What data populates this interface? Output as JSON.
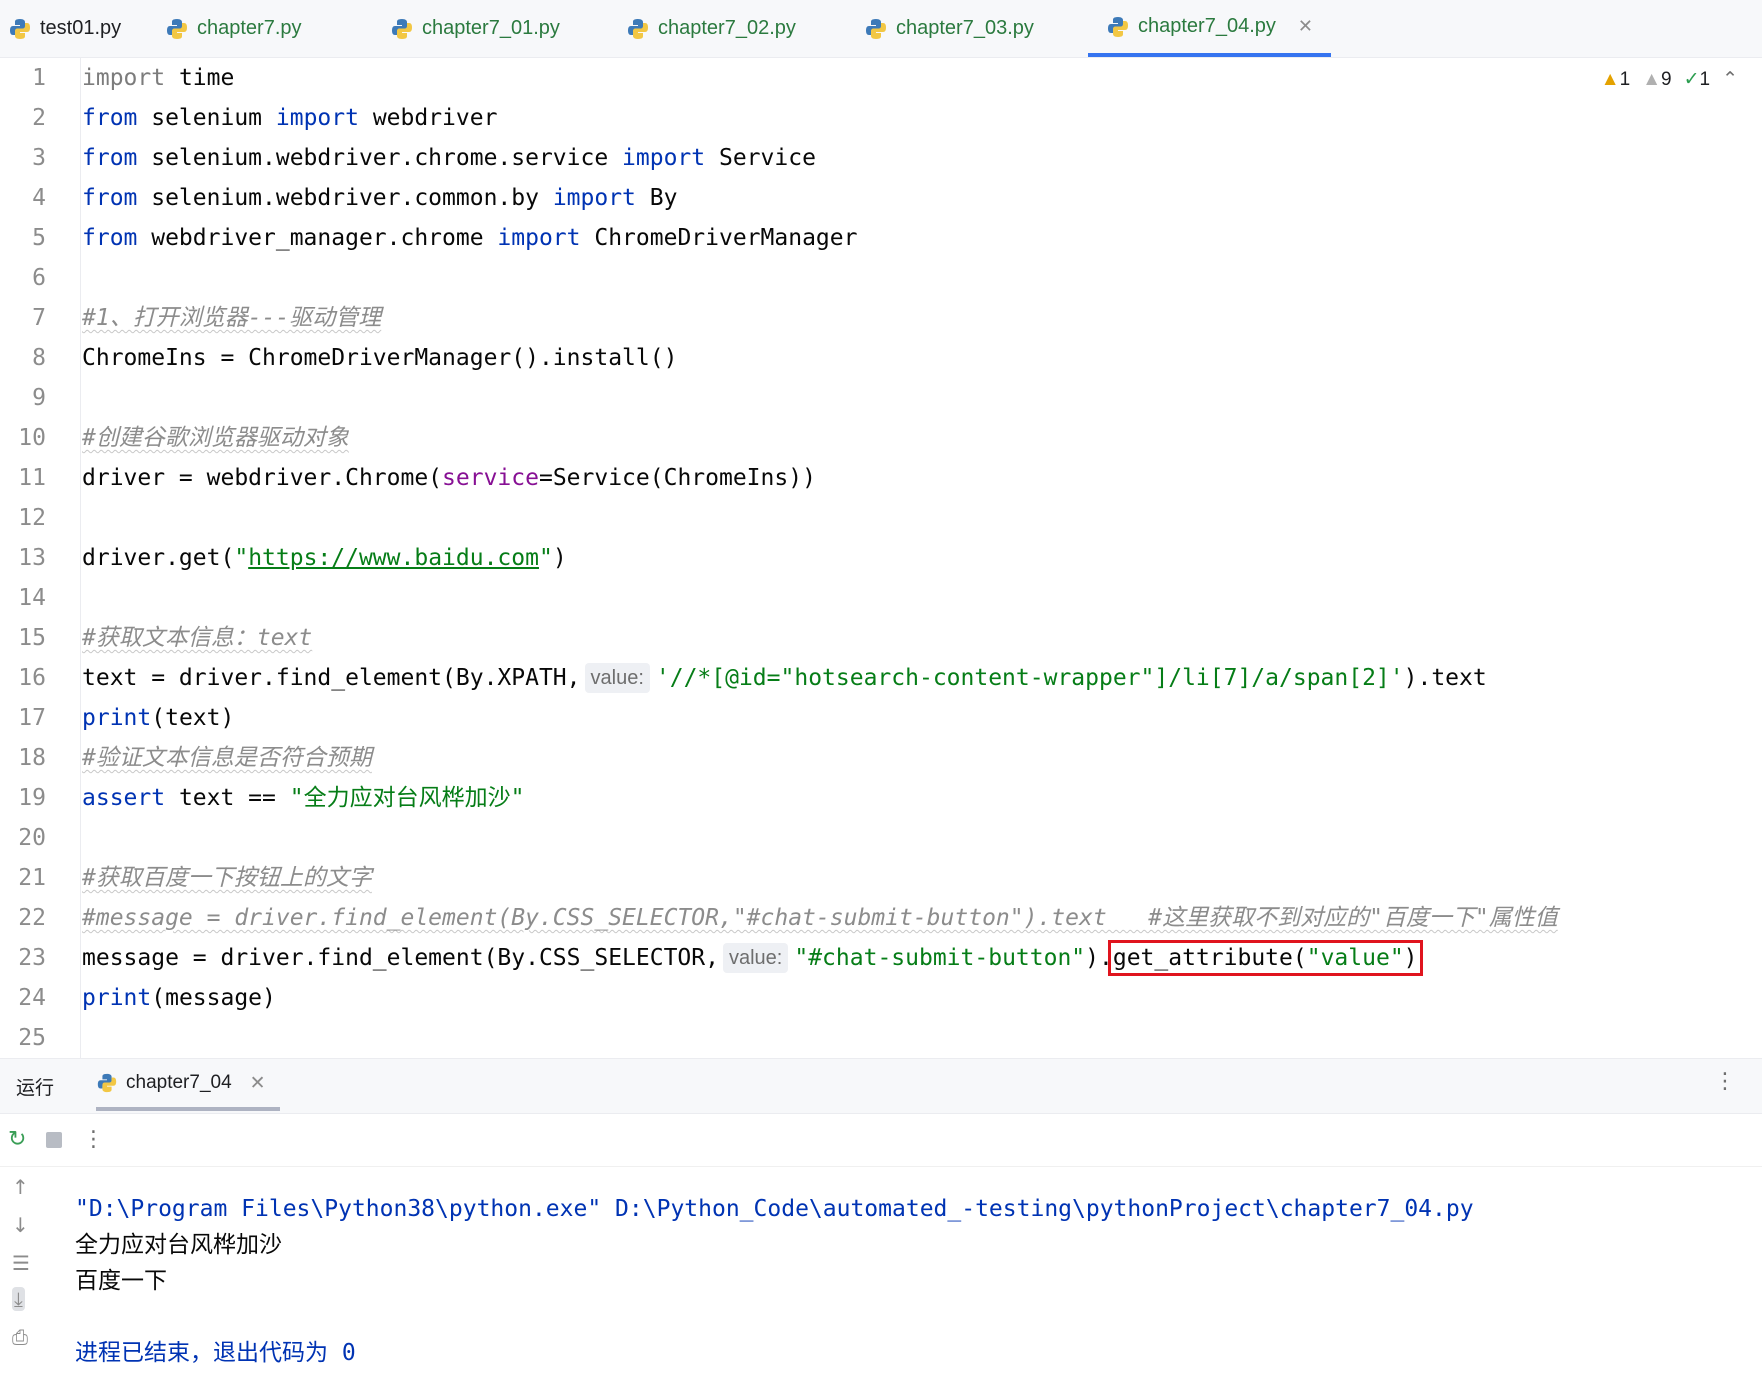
{
  "tabs": [
    {
      "label": "test01.py",
      "state": "plain"
    },
    {
      "label": "chapter7.py",
      "state": "normal"
    },
    {
      "label": "chapter7_01.py",
      "state": "normal"
    },
    {
      "label": "chapter7_02.py",
      "state": "normal"
    },
    {
      "label": "chapter7_03.py",
      "state": "normal"
    },
    {
      "label": "chapter7_04.py",
      "state": "active"
    }
  ],
  "inspections": {
    "warnings": "1",
    "weak_warnings": "9",
    "typos": "1"
  },
  "icons": {
    "python": "python-file-icon",
    "close": "close-icon",
    "warning": "warning-icon",
    "check": "check-icon"
  },
  "colors": {
    "keyword": "#0033b3",
    "string": "#067d17",
    "comment": "#8c8c8c",
    "highlight_box": "#e0141e",
    "active_tab": "#3574f0"
  },
  "editor": {
    "line_numbers": [
      "1",
      "2",
      "3",
      "4",
      "5",
      "6",
      "7",
      "8",
      "9",
      "10",
      "11",
      "12",
      "13",
      "14",
      "15",
      "16",
      "17",
      "18",
      "19",
      "20",
      "21",
      "22",
      "23",
      "24",
      "25"
    ],
    "hint_label": "value:",
    "lines": {
      "l1": {
        "a": "import",
        "b": " time"
      },
      "l2": {
        "a": "from",
        "b": " selenium ",
        "c": "import",
        "d": " webdriver"
      },
      "l3": {
        "a": "from",
        "b": " selenium.webdriver.chrome.service ",
        "c": "import",
        "d": " Service"
      },
      "l4": {
        "a": "from",
        "b": " selenium.webdriver.common.by ",
        "c": "import",
        "d": " By"
      },
      "l5": {
        "a": "from",
        "b": " webdriver_manager.chrome ",
        "c": "import",
        "d": " ChromeDriverManager"
      },
      "l7": {
        "comment": "#1、打开浏览器---驱动管理"
      },
      "l8": {
        "code": "ChromeIns = ChromeDriverManager().install()"
      },
      "l10": {
        "comment": "#创建谷歌浏览器驱动对象"
      },
      "l11": {
        "a": "driver = webdriver.Chrome(",
        "b": "service",
        "c": "=Service(ChromeIns))"
      },
      "l13": {
        "a": "driver.get(",
        "q1": "\"",
        "url": "https://www.baidu.com",
        "q2": "\"",
        "b": ")"
      },
      "l15": {
        "comment": "#获取文本信息：text"
      },
      "l16": {
        "a": "text = driver.find_element(By.XPATH,",
        "str": "'//*[@id=\"hotsearch-content-wrapper\"]/li[7]/a/span[2]'",
        "b": ").text"
      },
      "l17": {
        "a": "print",
        "b": "(text)"
      },
      "l18": {
        "comment": "#验证文本信息是否符合预期"
      },
      "l19": {
        "a": "assert",
        "b": " text == ",
        "str": "\"全力应对台风桦加沙\""
      },
      "l21": {
        "comment": "#获取百度一下按钮上的文字"
      },
      "l22": {
        "comment": "#message = driver.find_element(By.CSS_SELECTOR,\"#chat-submit-button\").text   #这里获取不到对应的\"百度一下\"属性值"
      },
      "l23": {
        "a": "message = driver.find_element(By.CSS_SELECTOR,",
        "str": "\"#chat-submit-button\"",
        "b": ").",
        "hl_a": "get_attribute(",
        "hl_str": "\"value\"",
        "hl_b": ")"
      },
      "l24": {
        "a": "print",
        "b": "(message)"
      }
    }
  },
  "run_panel": {
    "title": "运行",
    "tab_label": "chapter7_04",
    "output": {
      "command_a": "\"D:\\Program Files\\Python38\\python.exe\"",
      "command_b": " D:\\Python_Code\\automated_-testing\\pythonProject\\chapter7_04.py",
      "line1": "全力应对台风桦加沙",
      "line2": "百度一下",
      "exit": "进程已结束，退出代码为 0"
    }
  }
}
